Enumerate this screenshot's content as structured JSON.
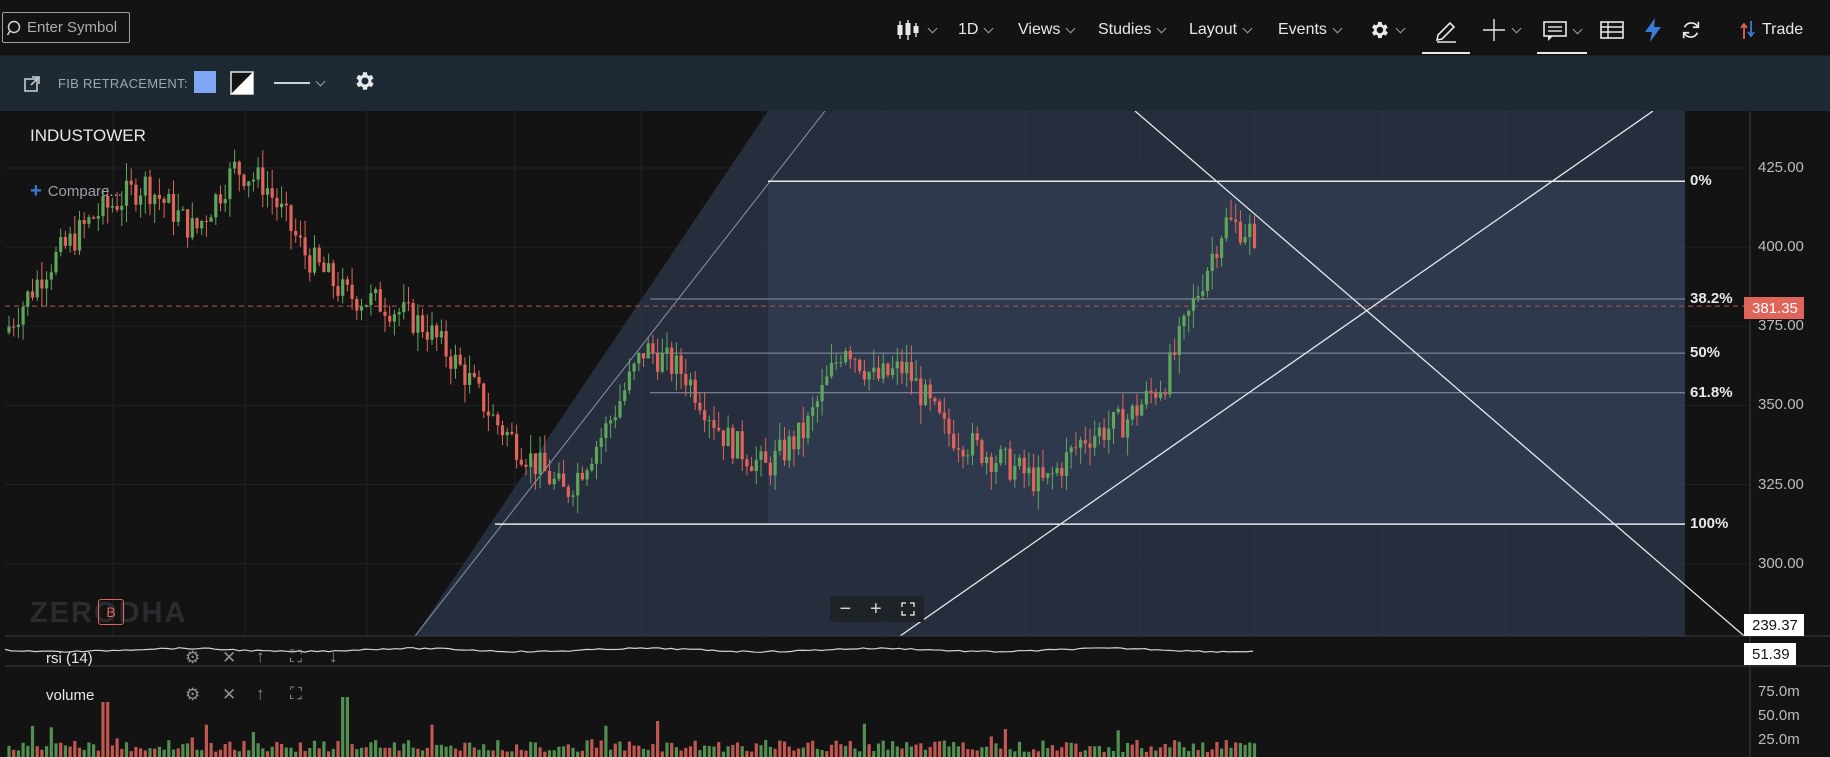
{
  "search": {
    "placeholder": "Enter Symbol"
  },
  "toolbar": {
    "interval": "1D",
    "views": "Views",
    "studies": "Studies",
    "layout": "Layout",
    "events": "Events",
    "trade": "Trade"
  },
  "fib_toolbar": {
    "label": "FIB RETRACEMENT:",
    "fill_color": "#7ea6f2"
  },
  "chart": {
    "symbol": "INDUSTOWER",
    "compare": "Compare...",
    "watermark": "ZERODHA",
    "badge": "B",
    "price_axis": [
      "425.00",
      "400.00",
      "375.00",
      "350.00",
      "325.00",
      "300.00"
    ],
    "fib_levels": [
      {
        "label": "0%",
        "price": 420.8
      },
      {
        "label": "38.2%",
        "price": 383.6
      },
      {
        "label": "50%",
        "price": 366.5
      },
      {
        "label": "61.8%",
        "price": 354.0
      },
      {
        "label": "100%",
        "price": 312.5
      }
    ],
    "last_price": "381.35",
    "last_price_color": "#e0645a",
    "trend_line_tag": "239.37",
    "candles_up_color": "#5fa65c",
    "candles_down_color": "#e0645a"
  },
  "rsi_pane": {
    "label": "rsi (14)",
    "value": "51.39"
  },
  "volume_pane": {
    "label": "volume",
    "axis": [
      "75.0m",
      "50.0m",
      "25.0m"
    ]
  }
}
